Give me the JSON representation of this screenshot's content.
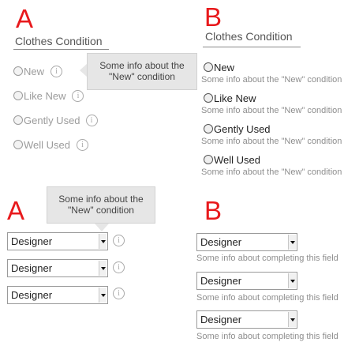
{
  "variant_labels": {
    "top_a": "A",
    "top_b": "B",
    "bottom_a": "A",
    "bottom_b": "B"
  },
  "section_title": "Clothes Condition",
  "radio_options": [
    "New",
    "Like New",
    "Gently Used",
    "Well Used"
  ],
  "radio_help": "Some info about the \"New\" condition",
  "tooltip_top": {
    "line1": "Some info about the",
    "line2": "\"New\" condition"
  },
  "tooltip_bottom": {
    "line1": "Some info about the",
    "line2": "\"New\" condition"
  },
  "select_value": "Designer",
  "select_help": "Some info about completing this field",
  "info_glyph": "i",
  "colors": {
    "accent_letter": "#e8191c",
    "tooltip_bg": "#e6e6e6",
    "help_text": "#8e8e8e"
  }
}
